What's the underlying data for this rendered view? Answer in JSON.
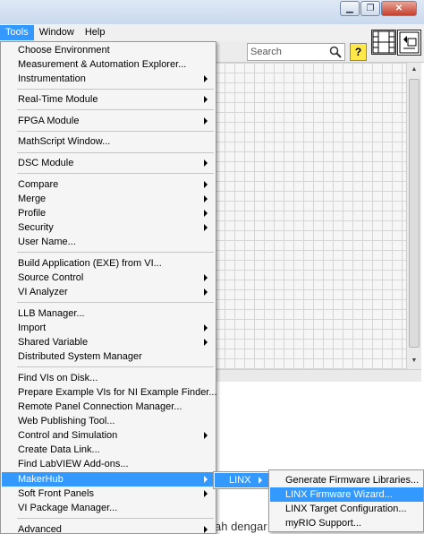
{
  "menubar": {
    "items": [
      {
        "label": "Tools",
        "active": true
      },
      {
        "label": "Window",
        "active": false
      },
      {
        "label": "Help",
        "active": false
      }
    ]
  },
  "window_controls": {
    "minimize": "▁",
    "restore": "❐",
    "close": "✕"
  },
  "toolbar": {
    "search_placeholder": "Search",
    "help_label": "?"
  },
  "background_text": "ah dengar",
  "colors": {
    "highlight": "#3399ff",
    "menu_bg": "#f5f5f5",
    "help_yellow": "#ffe94a"
  },
  "tools_menu": {
    "items": [
      {
        "label": "Choose Environment",
        "submenu": false
      },
      {
        "label": "Measurement & Automation Explorer...",
        "submenu": false
      },
      {
        "label": "Instrumentation",
        "submenu": true
      },
      {
        "label": "Real-Time Module",
        "submenu": true
      },
      {
        "label": "FPGA Module",
        "submenu": true
      },
      {
        "label": "MathScript Window...",
        "submenu": false
      },
      {
        "label": "DSC Module",
        "submenu": true
      },
      {
        "label": "Compare",
        "submenu": true
      },
      {
        "label": "Merge",
        "submenu": true
      },
      {
        "label": "Profile",
        "submenu": true
      },
      {
        "label": "Security",
        "submenu": true
      },
      {
        "label": "User Name...",
        "submenu": false
      },
      {
        "label": "Build Application (EXE) from VI...",
        "submenu": false
      },
      {
        "label": "Source Control",
        "submenu": true
      },
      {
        "label": "VI Analyzer",
        "submenu": true
      },
      {
        "label": "LLB Manager...",
        "submenu": false
      },
      {
        "label": "Import",
        "submenu": true
      },
      {
        "label": "Shared Variable",
        "submenu": true
      },
      {
        "label": "Distributed System Manager",
        "submenu": false
      },
      {
        "label": "Find VIs on Disk...",
        "submenu": false
      },
      {
        "label": "Prepare Example VIs for NI Example Finder...",
        "submenu": false
      },
      {
        "label": "Remote Panel Connection Manager...",
        "submenu": false
      },
      {
        "label": "Web Publishing Tool...",
        "submenu": false
      },
      {
        "label": "Control and Simulation",
        "submenu": true
      },
      {
        "label": "Create Data Link...",
        "submenu": false
      },
      {
        "label": "Find LabVIEW Add-ons...",
        "submenu": false
      },
      {
        "label": "MakerHub",
        "submenu": true,
        "highlighted": true
      },
      {
        "label": "Soft Front Panels",
        "submenu": true
      },
      {
        "label": "VI Package Manager...",
        "submenu": false
      },
      {
        "label": "Advanced",
        "submenu": true
      }
    ]
  },
  "makerhub_submenu": {
    "items": [
      {
        "label": "LINX",
        "submenu": true,
        "highlighted": true
      }
    ]
  },
  "linx_submenu": {
    "items": [
      {
        "label": "Generate Firmware Libraries...",
        "highlighted": false
      },
      {
        "label": "LINX Firmware Wizard...",
        "highlighted": true
      },
      {
        "label": "LINX Target Configuration...",
        "highlighted": false
      },
      {
        "label": "myRIO Support...",
        "highlighted": false
      }
    ]
  }
}
